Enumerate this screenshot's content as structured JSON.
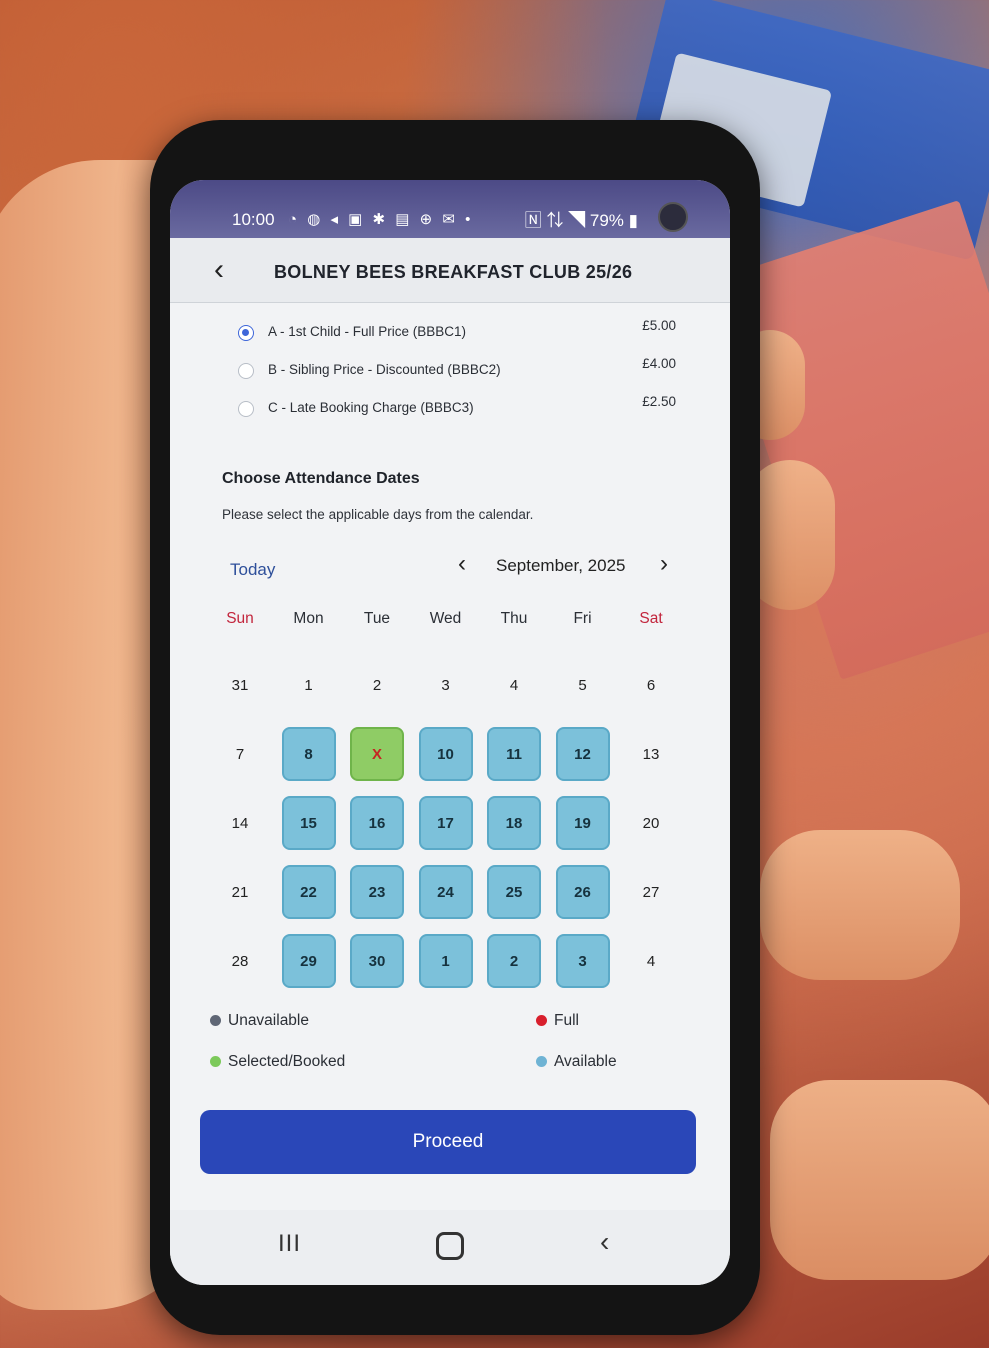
{
  "status_bar": {
    "time": "10:00",
    "icons_text": "◔ ◍ ◂ ▣ ✱ ▤ ⊕ ✉ •",
    "right": "🄽 ⇅ ◥ 79% ▮"
  },
  "header": {
    "back_icon": "chevron-left-icon",
    "title": "BOLNEY BEES BREAKFAST CLUB 25/26"
  },
  "price_options": [
    {
      "label": "A - 1st Child - Full Price (BBBC1)",
      "price": "£5.00",
      "selected": true
    },
    {
      "label": "B - Sibling Price - Discounted (BBBC2)",
      "price": "£4.00",
      "selected": false
    },
    {
      "label": "C - Late Booking Charge (BBBC3)",
      "price": "£2.50",
      "selected": false
    }
  ],
  "attendance": {
    "title": "Choose Attendance Dates",
    "subtitle": "Please select the applicable days from the calendar."
  },
  "calendar": {
    "today_label": "Today",
    "month_label": "September, 2025",
    "weekdays": [
      "Sun",
      "Mon",
      "Tue",
      "Wed",
      "Thu",
      "Fri",
      "Sat"
    ],
    "weeks": [
      [
        {
          "d": "31",
          "s": "none"
        },
        {
          "d": "1",
          "s": "none"
        },
        {
          "d": "2",
          "s": "none"
        },
        {
          "d": "3",
          "s": "none"
        },
        {
          "d": "4",
          "s": "none"
        },
        {
          "d": "5",
          "s": "none"
        },
        {
          "d": "6",
          "s": "none"
        }
      ],
      [
        {
          "d": "7",
          "s": "none"
        },
        {
          "d": "8",
          "s": "avail"
        },
        {
          "d": "X",
          "s": "booked"
        },
        {
          "d": "10",
          "s": "avail"
        },
        {
          "d": "11",
          "s": "avail"
        },
        {
          "d": "12",
          "s": "avail"
        },
        {
          "d": "13",
          "s": "none"
        }
      ],
      [
        {
          "d": "14",
          "s": "none"
        },
        {
          "d": "15",
          "s": "avail"
        },
        {
          "d": "16",
          "s": "avail"
        },
        {
          "d": "17",
          "s": "avail"
        },
        {
          "d": "18",
          "s": "avail"
        },
        {
          "d": "19",
          "s": "avail"
        },
        {
          "d": "20",
          "s": "none"
        }
      ],
      [
        {
          "d": "21",
          "s": "none"
        },
        {
          "d": "22",
          "s": "avail"
        },
        {
          "d": "23",
          "s": "avail"
        },
        {
          "d": "24",
          "s": "avail"
        },
        {
          "d": "25",
          "s": "avail"
        },
        {
          "d": "26",
          "s": "avail"
        },
        {
          "d": "27",
          "s": "none"
        }
      ],
      [
        {
          "d": "28",
          "s": "none"
        },
        {
          "d": "29",
          "s": "avail"
        },
        {
          "d": "30",
          "s": "avail"
        },
        {
          "d": "1",
          "s": "avail"
        },
        {
          "d": "2",
          "s": "avail"
        },
        {
          "d": "3",
          "s": "avail"
        },
        {
          "d": "4",
          "s": "none"
        }
      ]
    ]
  },
  "legend": {
    "unavailable": "Unavailable",
    "full": "Full",
    "selected": "Selected/Booked",
    "available": "Available",
    "colors": {
      "unavailable": "#5f6675",
      "full": "#d81f2c",
      "selected": "#7cc95a",
      "available": "#6fb3d4"
    }
  },
  "proceed_label": "Proceed",
  "nav": {
    "recent": "III",
    "back": "‹"
  }
}
